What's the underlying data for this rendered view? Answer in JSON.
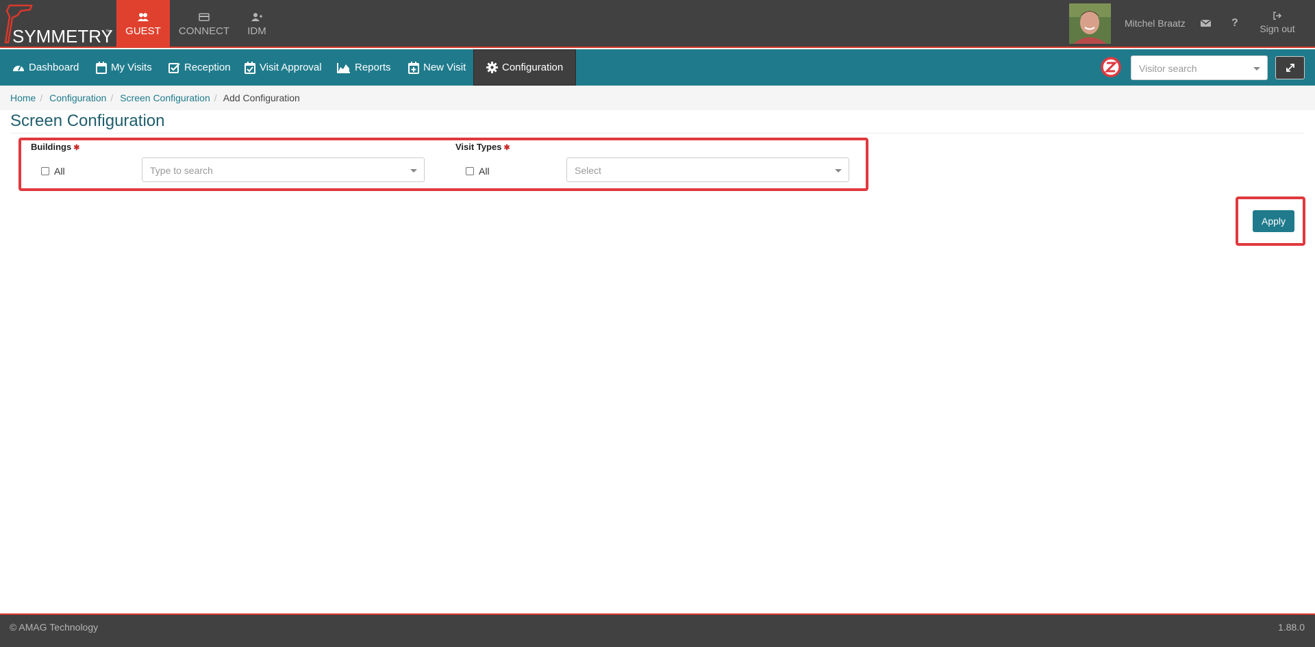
{
  "brand": {
    "logo_text": "SYMMETRY",
    "trademark": "™"
  },
  "app_tabs": [
    {
      "label": "GUEST",
      "icon": "users-icon",
      "active": true
    },
    {
      "label": "CONNECT",
      "icon": "card-icon",
      "active": false
    },
    {
      "label": "IDM",
      "icon": "user-plus-icon",
      "active": false
    }
  ],
  "user": {
    "name": "Mitchel Braatz",
    "signout_label": "Sign out"
  },
  "nav": {
    "items": [
      {
        "label": "Dashboard",
        "icon": "dashboard-icon"
      },
      {
        "label": "My Visits",
        "icon": "calendar-icon"
      },
      {
        "label": "Reception",
        "icon": "check-square-icon"
      },
      {
        "label": "Visit Approval",
        "icon": "calendar-check-icon"
      },
      {
        "label": "Reports",
        "icon": "area-chart-icon"
      },
      {
        "label": "New Visit",
        "icon": "calendar-plus-icon"
      },
      {
        "label": "Configuration",
        "icon": "gear-icon",
        "active": true
      }
    ],
    "visitor_search_placeholder": "Visitor search"
  },
  "breadcrumb": {
    "items": [
      "Home",
      "Configuration",
      "Screen Configuration"
    ],
    "current": "Add Configuration"
  },
  "page": {
    "title": "Screen Configuration"
  },
  "filters": {
    "buildings": {
      "label": "Buildings",
      "all_label": "All",
      "placeholder": "Type to search"
    },
    "visit_types": {
      "label": "Visit Types",
      "all_label": "All",
      "placeholder": "Select"
    },
    "apply_label": "Apply"
  },
  "footer": {
    "copyright": "© AMAG Technology",
    "version": "1.88.0"
  },
  "colors": {
    "accent": "#1f7b8c",
    "brand_red": "#e0412f",
    "header_bg": "#414141"
  }
}
